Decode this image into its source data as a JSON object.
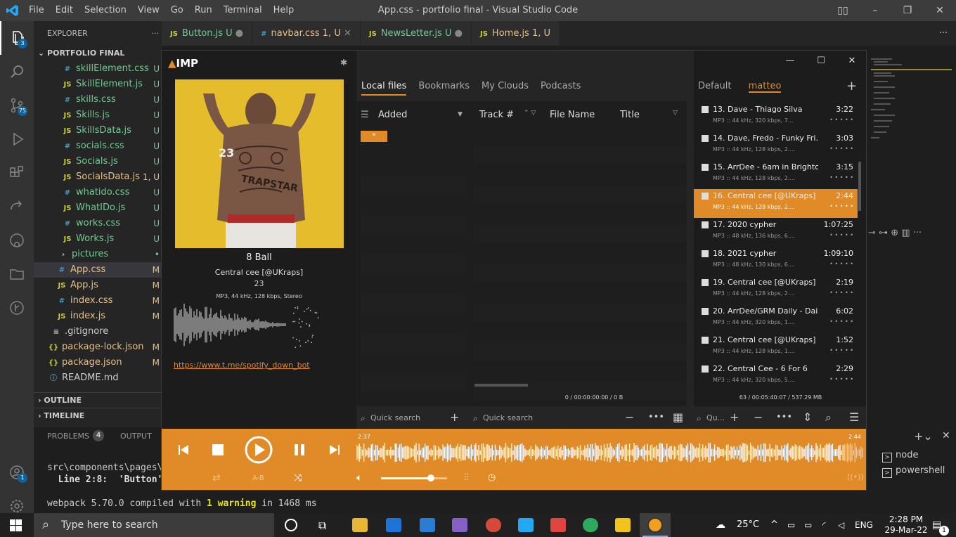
{
  "vscode": {
    "menu": [
      "File",
      "Edit",
      "Selection",
      "View",
      "Go",
      "Run",
      "Terminal",
      "Help"
    ],
    "window_title": "App.css - portfolio final - Visual Studio Code",
    "explorer_label": "EXPLORER",
    "project": "PORTFOLIO FINAL",
    "activity_badges": {
      "explorer": "3",
      "scm": "75",
      "account": "1"
    },
    "files": [
      {
        "name": "skillElement.css",
        "type": "css",
        "status": "U"
      },
      {
        "name": "SkillElement.js",
        "type": "js",
        "status": "U"
      },
      {
        "name": "skills.css",
        "type": "css",
        "status": "U"
      },
      {
        "name": "Skills.js",
        "type": "js",
        "status": "U"
      },
      {
        "name": "SkillsData.js",
        "type": "js",
        "status": "U"
      },
      {
        "name": "socials.css",
        "type": "css",
        "status": "U"
      },
      {
        "name": "Socials.js",
        "type": "js",
        "status": "U"
      },
      {
        "name": "SocialsData.js",
        "type": "js",
        "status": "1, U"
      },
      {
        "name": "whatido.css",
        "type": "css",
        "status": "U"
      },
      {
        "name": "WhatIDo.js",
        "type": "js",
        "status": "U"
      },
      {
        "name": "works.css",
        "type": "css",
        "status": "U"
      },
      {
        "name": "Works.js",
        "type": "js",
        "status": "U"
      },
      {
        "name": "pictures",
        "type": "folder",
        "status": "•"
      },
      {
        "name": "App.css",
        "type": "css",
        "status": "M"
      },
      {
        "name": "App.js",
        "type": "js",
        "status": "M"
      },
      {
        "name": "index.css",
        "type": "css",
        "status": "M"
      },
      {
        "name": "index.js",
        "type": "js",
        "status": "M"
      },
      {
        "name": ".gitignore",
        "type": "git",
        "status": ""
      },
      {
        "name": "package-lock.json",
        "type": "json",
        "status": "M"
      },
      {
        "name": "package.json",
        "type": "json",
        "status": "M"
      },
      {
        "name": "README.md",
        "type": "md",
        "status": ""
      }
    ],
    "sections": [
      "OUTLINE",
      "TIMELINE"
    ],
    "tabs": [
      {
        "label": "Button.js",
        "type": "JS",
        "status": "U"
      },
      {
        "label": "navbar.css",
        "type": "#",
        "status": "1, U"
      },
      {
        "label": "NewsLetter.js",
        "type": "JS",
        "status": "U"
      },
      {
        "label": "Home.js",
        "type": "JS",
        "status": "1, U"
      }
    ],
    "panel": {
      "problems": "PROBLEMS",
      "problems_count": "4",
      "output": "OUTPUT"
    },
    "terminal": {
      "line1": "src\\components\\pages\\Ho",
      "line2": "  Line 2:8:  'Button' i",
      "line3_pre": "webpack 5.70.0 compiled with ",
      "line3_warn": "1 warning",
      "line3_post": " in 1468 ms"
    },
    "terminals": [
      "node",
      "powershell"
    ]
  },
  "aimp": {
    "logo_a": "▲",
    "logo": "IMP",
    "track": {
      "title": "8 Ball",
      "artist": "Central cee [@UKraps]",
      "album": "23",
      "info": "MP3, 44 kHz, 128 kbps, Stereo"
    },
    "link": "https://www.t.me/spotify_down_bot",
    "tabs": [
      "Local files",
      "Bookmarks",
      "My Clouds",
      "Podcasts"
    ],
    "group_header": "Added",
    "chip": "*",
    "columns": [
      "Track #",
      "File Name",
      "Title"
    ],
    "status_left": "0 / 00:00:00:00 / 0 B",
    "playlist_tabs": [
      "Default",
      "matteo"
    ],
    "playlist": [
      {
        "title": "13. Dave - Thiago Silva",
        "dur": "3:22",
        "meta": "MP3 :: 44 kHz, 320 kbps, 7..."
      },
      {
        "title": "14. Dave, Fredo - Funky Fri...",
        "dur": "3:03",
        "meta": "MP3 :: 44 kHz, 128 kbps, 2...."
      },
      {
        "title": "15. ArrDee - 6am in Brighton",
        "dur": "3:15",
        "meta": "MP3 :: 44 kHz, 128 kbps, 2...."
      },
      {
        "title": "16. Central cee [@UKraps] - ...",
        "dur": "2:44",
        "meta": "MP3 :: 44 kHz, 128 kbps, 2...."
      },
      {
        "title": "17. 2020 cypher",
        "dur": "1:07:25",
        "meta": "MP3 :: 48 kHz, 136 kbps, 6...."
      },
      {
        "title": "18. 2021 cypher",
        "dur": "1:09:10",
        "meta": "MP3 :: 48 kHz, 130 kbps, 6...."
      },
      {
        "title": "19. Central cee [@UKraps] - ...",
        "dur": "2:19",
        "meta": "MP3 :: 44 kHz, 128 kbps, 2...."
      },
      {
        "title": "20. ArrDee/GRM Daily - Dail...",
        "dur": "6:02",
        "meta": "MP3 :: 44 kHz, 320 kbps, 1...."
      },
      {
        "title": "21. Central cee [@UKraps] - ...",
        "dur": "1:52",
        "meta": "MP3 :: 44 kHz, 128 kbps, 1...."
      },
      {
        "title": "22. Central Cee - 6 For 6",
        "dur": "2:29",
        "meta": "MP3 :: 44 kHz, 320 kbps, 5...."
      }
    ],
    "playlist_status": "63 / 00:05:40:07 / 537.29 MB",
    "search": {
      "left": "Quick search",
      "mid": "Quick search",
      "right": "Qu..."
    },
    "elapsed": "2:37",
    "total": "2:44",
    "ab": "A-B",
    "volume": 0.75,
    "position": 0.96
  },
  "taskbar": {
    "search_placeholder": "Type here to search",
    "weather": "25°C",
    "lang": "ENG",
    "time": "2:28 PM",
    "date": "29-Mar-22",
    "notif": "1"
  }
}
